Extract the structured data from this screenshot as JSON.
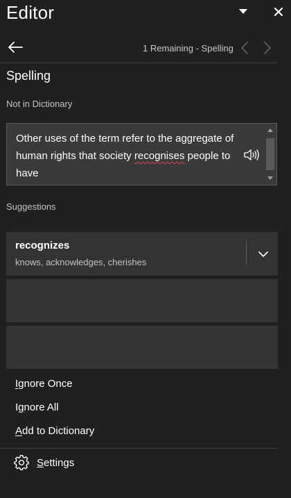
{
  "window": {
    "title": "Editor",
    "dropdown_icon": "triangle-down-icon",
    "close_icon": "close-icon"
  },
  "navigation": {
    "back_icon": "arrow-left-icon",
    "status": "1 Remaining - Spelling",
    "prev_icon": "chevron-left-icon",
    "next_icon": "chevron-right-icon"
  },
  "section": {
    "title": "Spelling",
    "context_label": "Not in Dictionary"
  },
  "context": {
    "text_before": "Other uses of the term refer to the aggregate of human rights that society ",
    "misspelled_word": "recognises",
    "text_after": " people to have",
    "speaker_icon": "speaker-icon"
  },
  "suggestions": {
    "label": "Suggestions",
    "primary_word": "recognizes",
    "primary_synonyms": "knows, acknowledges, cherishes",
    "expand_icon": "chevron-down-icon"
  },
  "actions": {
    "ignore_once_accel": "I",
    "ignore_once_rest": "gnore Once",
    "ignore_all_pre": "I",
    "ignore_all_accel": "g",
    "ignore_all_rest": "nore All",
    "add_dict_accel": "A",
    "add_dict_rest": "dd to Dictionary"
  },
  "settings": {
    "icon": "gear-icon",
    "label_accel": "S",
    "label_rest": "ettings"
  },
  "colors": {
    "background": "#202020",
    "card": "#333333",
    "misspell_underline": "#e8484a"
  }
}
